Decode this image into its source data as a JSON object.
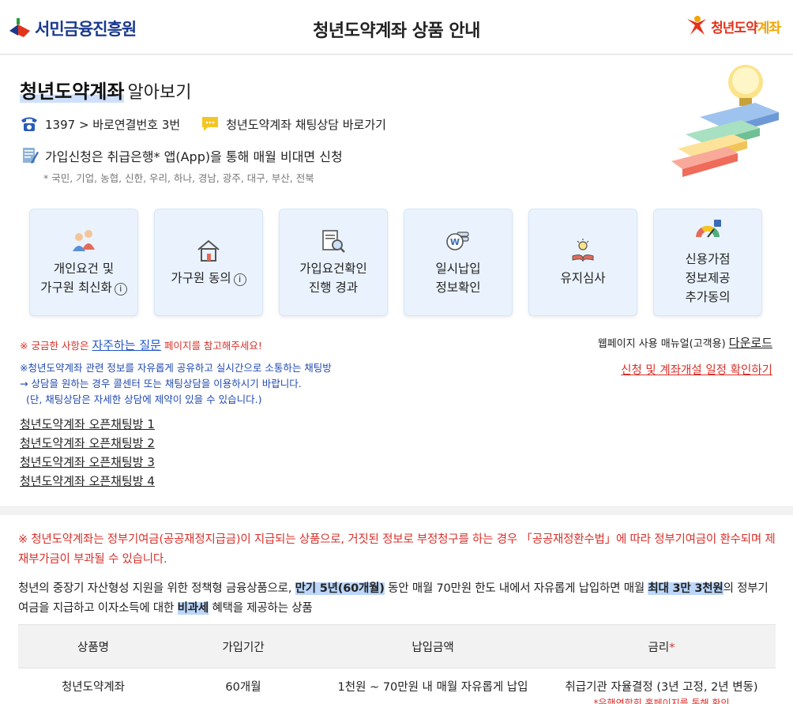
{
  "header": {
    "logo_left_text": "서민금융진흥원",
    "title": "청년도약계좌 상품 안내",
    "logo_right_text_a": "청년도약",
    "logo_right_text_b": "계좌"
  },
  "intro": {
    "title_highlight": "청년도약계좌",
    "title_rest": "알아보기",
    "phone_text": "1397 > 바로연결번호 3번",
    "chat_text": "청년도약계좌 채팅상담 바로가기",
    "apply_text": "가입신청은 취급은행* 앱(App)을 통해 매월 비대면 신청",
    "banks_text": "* 국민, 기업, 농협, 신한, 우리, 하나, 경남, 광주, 대구, 부산, 전북"
  },
  "cards": [
    {
      "label_line1": "개인요건 및",
      "label_line2": "가구원 최신화",
      "has_info": true
    },
    {
      "label_line1": "가구원 동의",
      "label_line2": "",
      "has_info": true
    },
    {
      "label_line1": "가입요건확인",
      "label_line2": "진행 경과",
      "has_info": false
    },
    {
      "label_line1": "일시납입",
      "label_line2": "정보확인",
      "has_info": false
    },
    {
      "label_line1": "유지심사",
      "label_line2": "",
      "has_info": false
    },
    {
      "label_line1": "신용가점",
      "label_line2": "정보제공",
      "label_line3": "추가동의",
      "has_info": false
    }
  ],
  "info_glyph": "i",
  "faq": {
    "prefix": "※ 궁금한 사항은 ",
    "link": "자주하는 질문",
    "suffix": " 페이지를 참고해주세요!"
  },
  "manual": {
    "prefix": "웹페이지 사용 매뉴얼(고객용) ",
    "link": "다운로드"
  },
  "schedule_link": "신청 및 계좌개설 일정 확인하기",
  "chat_info": [
    "※청년도약계좌 관련 정보를 자유롭게 공유하고 실시간으로 소통하는 채팅방",
    "→ 상담을 원하는 경우 콜센터 또는 채팅상담을 이용하시기 바랍니다.",
    "  (단, 채팅상담은 자세한 상담에 제약이 있을 수 있습니다.)"
  ],
  "rooms": [
    "청년도약계좌 오픈채팅방 1",
    "청년도약계좌 오픈채팅방 2",
    "청년도약계좌 오픈채팅방 3",
    "청년도약계좌 오픈채팅방 4"
  ],
  "warning": "※ 청년도약계좌는 정부기여금(공공재정지급금)이 지급되는 상품으로, 거짓된 정보로 부정청구를 하는 경우 「공공재정환수법」에 따라 정부기여금이 환수되며 제재부가금이 부과될 수 있습니다.",
  "description": {
    "part1": "청년의 중장기 자산형성 지원을 위한 정책형 금융상품으로, ",
    "mark1": "만기 5년(60개월)",
    "part2": " 동안 매월 70만원 한도 내에서 자유롭게 납입하면 매월 ",
    "mark2": "최대 3만 3천원",
    "part3": "의 정부기여금을 지급하고 이자소득에 대한 ",
    "mark3": "비과세",
    "part4": " 혜택을 제공하는 상품"
  },
  "table": {
    "headers": [
      "상품명",
      "가입기간",
      "납입금액",
      "금리"
    ],
    "rate_marker": "*",
    "row": {
      "name": "청년도약계좌",
      "period": "60개월",
      "amount": "1천원 ~ 70만원 내 매월 자유롭게 납입",
      "rate": "취급기관 자율결정 (3년 고정, 2년 변동)",
      "rate_note": "*은행연합회 홈페이지를 통해 확인"
    }
  },
  "colors": {
    "accent_blue": "#1f56c9",
    "warning_red": "#d8302a",
    "card_bg": "#eaf3fd",
    "highlight": "#bcd7fb"
  }
}
